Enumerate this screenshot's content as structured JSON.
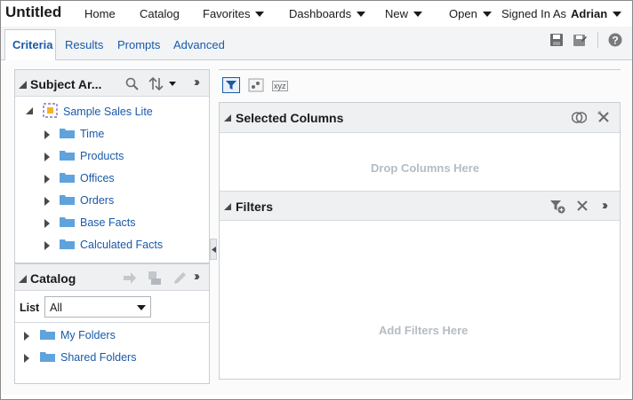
{
  "header": {
    "title": "Untitled",
    "nav": {
      "home": "Home",
      "catalog": "Catalog",
      "favorites": "Favorites",
      "dashboards": "Dashboards",
      "new": "New",
      "open": "Open",
      "signed_in_label": "Signed In As",
      "user": "Adrian"
    }
  },
  "tabs": {
    "criteria": "Criteria",
    "results": "Results",
    "prompts": "Prompts",
    "advanced": "Advanced"
  },
  "subject_area": {
    "title": "Subject Ar...",
    "root": "Sample Sales Lite",
    "folders": [
      "Time",
      "Products",
      "Offices",
      "Orders",
      "Base Facts",
      "Calculated Facts"
    ]
  },
  "catalog": {
    "title": "Catalog",
    "list_label": "List",
    "list_value": "All",
    "folders": [
      "My Folders",
      "Shared Folders"
    ]
  },
  "selected_columns": {
    "title": "Selected Columns",
    "hint": "Drop Columns Here"
  },
  "filters": {
    "title": "Filters",
    "hint": "Add Filters Here"
  },
  "toolbar_icons": {
    "xyz_label": "xyz"
  },
  "colors": {
    "link": "#1a5aa8",
    "panel_header": "#eef0f2",
    "hint_text": "#b5bcc4",
    "folder": "#5fa3dc"
  }
}
